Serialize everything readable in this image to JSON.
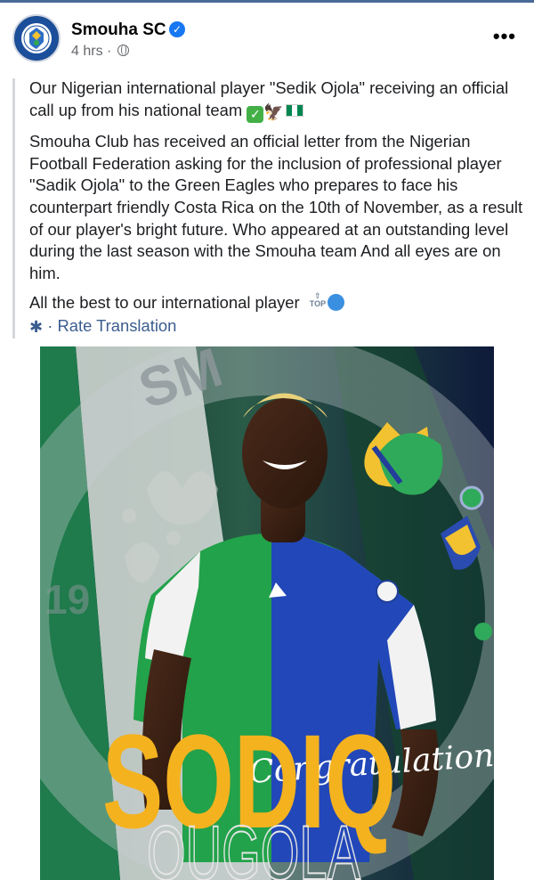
{
  "post": {
    "page_name": "Smouha SC",
    "time": "4 hrs",
    "separator": "·",
    "more_label": "•••",
    "verified_mark": "✓",
    "paragraph1": "Our Nigerian international player \"Sedik Ojola\" receiving an official call up from his national team",
    "paragraph2": "Smouha Club has received an official letter from the Nigerian Football Federation asking for the inclusion of professional player \"Sadik Ojola\" to the Green Eagles who prepares to face his counterpart friendly Costa Rica on the 10th of November, as a result of our player's bright future. Who appeared at an outstanding level during the last season with the Smouha team And all eyes are on him.",
    "paragraph3": "All the best to our international player",
    "top_emoji_arrow": "⇧",
    "top_emoji_text": "TOP",
    "rate_separator": "·",
    "rate_translation": "Rate Translation"
  },
  "image": {
    "name_top": "SODIQ",
    "name_bottom": "OUGOLA",
    "congrats": "Congratulations"
  },
  "colors": {
    "accent": "#1877f2",
    "link": "#3b5d8f",
    "poster_yellow": "#f4b21f",
    "jersey_green": "#22a24a",
    "jersey_blue": "#2247b8"
  }
}
